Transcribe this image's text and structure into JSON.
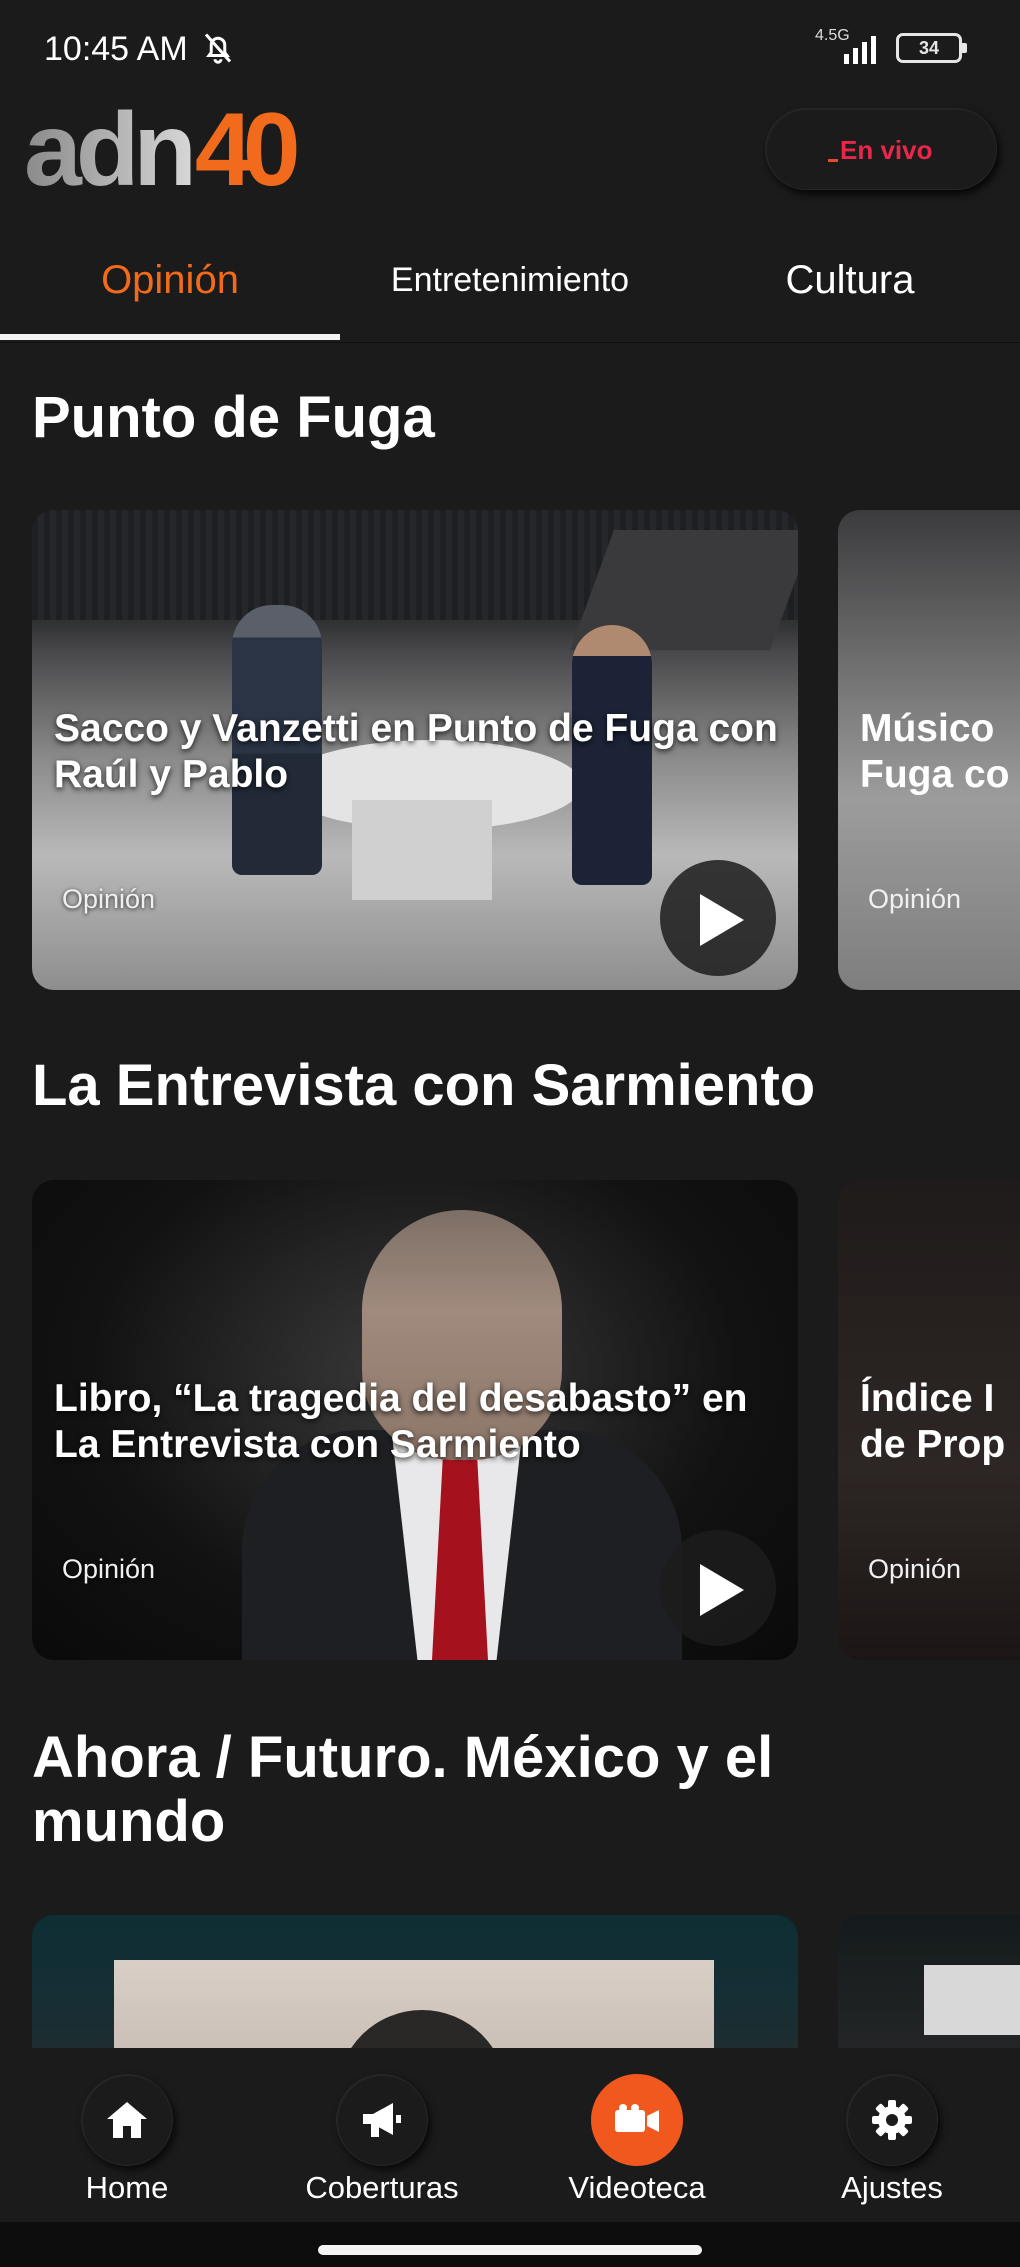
{
  "status_bar": {
    "time": "10:45 AM",
    "network": "4.5G",
    "battery": "34"
  },
  "header": {
    "logo_text": "adn",
    "logo_number": "40",
    "live_button": "En vivo"
  },
  "tabs": [
    {
      "label": "Opinión",
      "active": true
    },
    {
      "label": "Entretenimiento",
      "active": false
    },
    {
      "label": "Cultura",
      "active": false
    }
  ],
  "sections": [
    {
      "title": "Punto de Fuga",
      "cards": [
        {
          "title": "Sacco y Vanzetti en Punto de Fuga con Raúl y Pablo",
          "category": "Opinión"
        },
        {
          "title": "Músico Fuga co",
          "title_lines": [
            "Músico",
            "Fuga co"
          ],
          "category": "Opinión"
        }
      ]
    },
    {
      "title": "La Entrevista con Sarmiento",
      "cards": [
        {
          "title": "Libro, “La tragedia del desabasto” en La Entrevista con Sarmiento",
          "category": "Opinión"
        },
        {
          "title": "Índice l de Prop",
          "title_lines": [
            "Índice I",
            "de Prop"
          ],
          "category": "Opinión"
        }
      ]
    },
    {
      "title": "Ahora / Futuro. México y el mundo"
    }
  ],
  "bottom_nav": [
    {
      "label": "Home",
      "icon": "home-icon",
      "active": false
    },
    {
      "label": "Coberturas",
      "icon": "megaphone-icon",
      "active": false
    },
    {
      "label": "Videoteca",
      "icon": "video-camera-icon",
      "active": true
    },
    {
      "label": "Ajustes",
      "icon": "gear-icon",
      "active": false
    }
  ],
  "colors": {
    "accent": "#f26a1b",
    "live": "#e8274b",
    "background": "#1b1b1b"
  }
}
